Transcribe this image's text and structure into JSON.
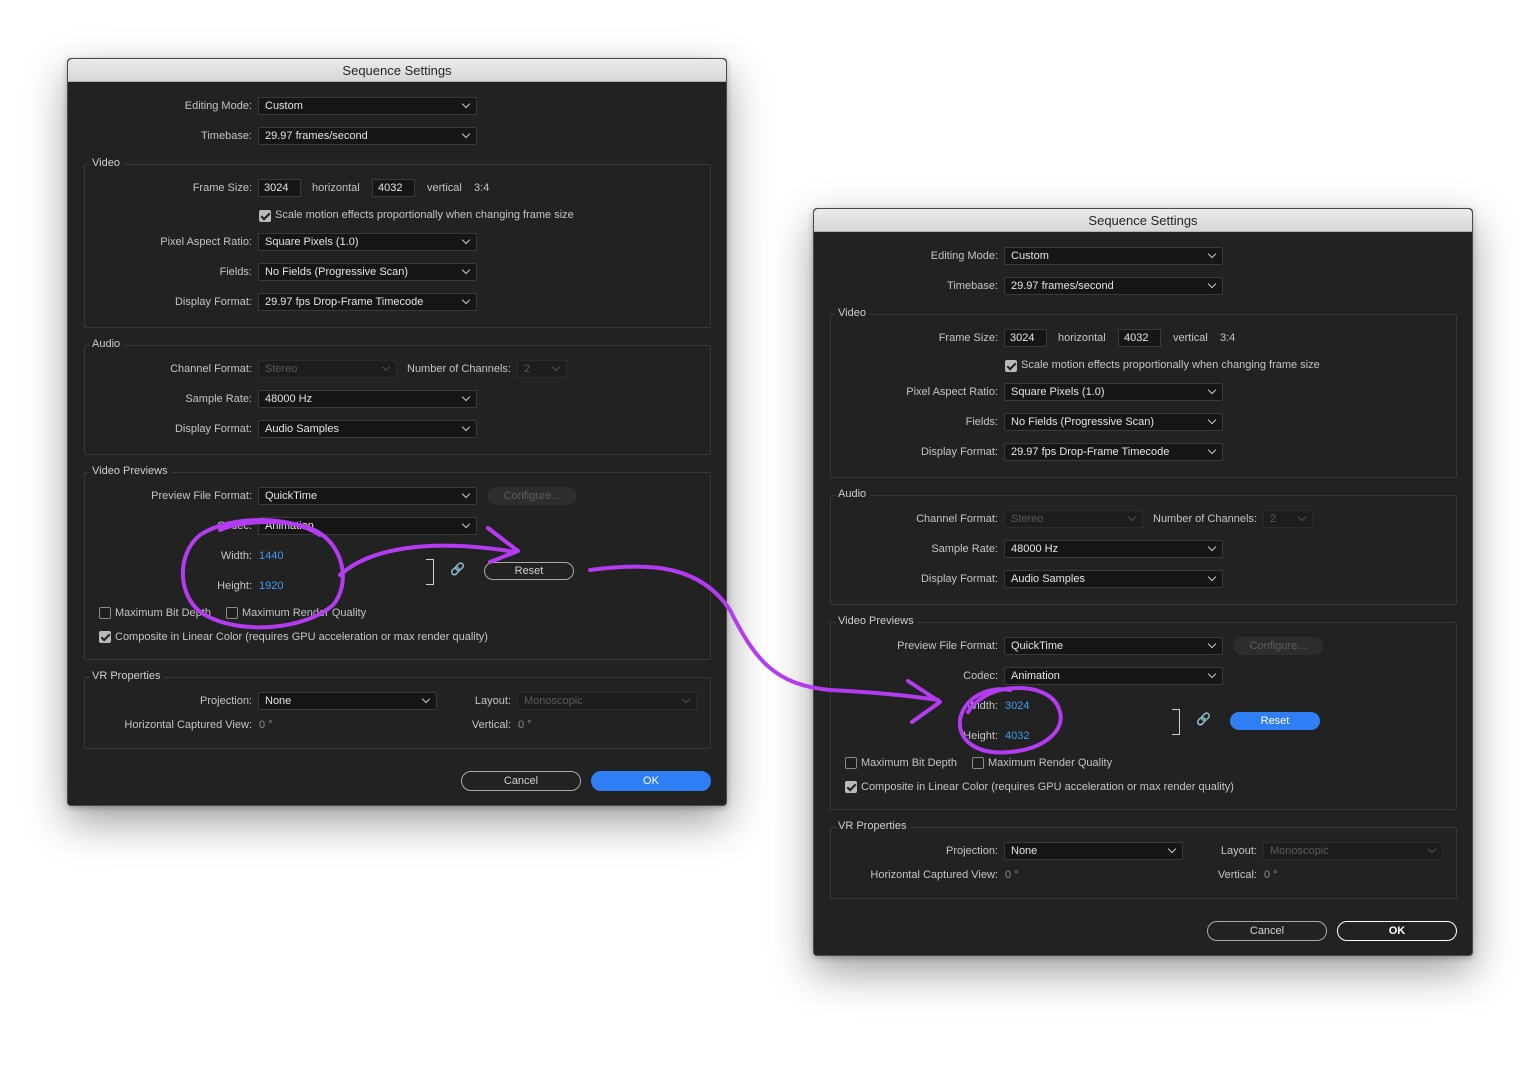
{
  "dialogs": [
    {
      "title": "Sequence Settings",
      "editing_mode": {
        "label": "Editing Mode:",
        "value": "Custom"
      },
      "timebase": {
        "label": "Timebase:",
        "value": "29.97  frames/second"
      },
      "video": {
        "section": "Video",
        "frame_size_label": "Frame Size:",
        "frame_width": "3024",
        "horizontal_label": "horizontal",
        "frame_height": "4032",
        "vertical_label": "vertical",
        "aspect": "3:4",
        "scale_checkbox_label": "Scale motion effects proportionally when changing frame size",
        "pixel_aspect": {
          "label": "Pixel Aspect Ratio:",
          "value": "Square Pixels (1.0)"
        },
        "fields": {
          "label": "Fields:",
          "value": "No Fields (Progressive Scan)"
        },
        "display_format": {
          "label": "Display Format:",
          "value": "29.97 fps Drop-Frame Timecode"
        }
      },
      "audio": {
        "section": "Audio",
        "channel_format": {
          "label": "Channel Format:",
          "value": "Stereo"
        },
        "channels": {
          "label": "Number of Channels:",
          "value": "2"
        },
        "sample_rate": {
          "label": "Sample Rate:",
          "value": "48000 Hz"
        },
        "display_format": {
          "label": "Display Format:",
          "value": "Audio Samples"
        }
      },
      "previews": {
        "section": "Video Previews",
        "file_format": {
          "label": "Preview File Format:",
          "value": "QuickTime"
        },
        "configure_label": "Configure...",
        "codec": {
          "label": "Codec:",
          "value": "Animation"
        },
        "width": {
          "label": "Width:",
          "value": "1440"
        },
        "height": {
          "label": "Height:",
          "value": "1920"
        },
        "reset_label": "Reset",
        "link_glyph": "🔗",
        "max_bit_depth_label": "Maximum Bit Depth",
        "max_render_label": "Maximum Render Quality",
        "composite_label": "Composite in Linear Color (requires GPU acceleration or max render quality)"
      },
      "vr": {
        "section": "VR Properties",
        "projection": {
          "label": "Projection:",
          "value": "None"
        },
        "layout": {
          "label": "Layout:",
          "value": "Monoscopic"
        },
        "hcv": {
          "label": "Horizontal Captured View:",
          "value": "0 °"
        },
        "vertical": {
          "label": "Vertical:",
          "value": "0 °"
        }
      },
      "cancel_label": "Cancel",
      "ok_label": "OK"
    },
    {
      "title": "Sequence Settings",
      "editing_mode": {
        "label": "Editing Mode:",
        "value": "Custom"
      },
      "timebase": {
        "label": "Timebase:",
        "value": "29.97  frames/second"
      },
      "video": {
        "section": "Video",
        "frame_size_label": "Frame Size:",
        "frame_width": "3024",
        "horizontal_label": "horizontal",
        "frame_height": "4032",
        "vertical_label": "vertical",
        "aspect": "3:4",
        "scale_checkbox_label": "Scale motion effects proportionally when changing frame size",
        "pixel_aspect": {
          "label": "Pixel Aspect Ratio:",
          "value": "Square Pixels (1.0)"
        },
        "fields": {
          "label": "Fields:",
          "value": "No Fields (Progressive Scan)"
        },
        "display_format": {
          "label": "Display Format:",
          "value": "29.97 fps Drop-Frame Timecode"
        }
      },
      "audio": {
        "section": "Audio",
        "channel_format": {
          "label": "Channel Format:",
          "value": "Stereo"
        },
        "channels": {
          "label": "Number of Channels:",
          "value": "2"
        },
        "sample_rate": {
          "label": "Sample Rate:",
          "value": "48000 Hz"
        },
        "display_format": {
          "label": "Display Format:",
          "value": "Audio Samples"
        }
      },
      "previews": {
        "section": "Video Previews",
        "file_format": {
          "label": "Preview File Format:",
          "value": "QuickTime"
        },
        "configure_label": "Configure...",
        "codec": {
          "label": "Codec:",
          "value": "Animation"
        },
        "width": {
          "label": "Width:",
          "value": "3024"
        },
        "height": {
          "label": "Height:",
          "value": "4032"
        },
        "reset_label": "Reset",
        "link_glyph": "🔗",
        "max_bit_depth_label": "Maximum Bit Depth",
        "max_render_label": "Maximum Render Quality",
        "composite_label": "Composite in Linear Color (requires GPU acceleration or max render quality)"
      },
      "vr": {
        "section": "VR Properties",
        "projection": {
          "label": "Projection:",
          "value": "None"
        },
        "layout": {
          "label": "Layout:",
          "value": "Monoscopic"
        },
        "hcv": {
          "label": "Horizontal Captured View:",
          "value": "0 °"
        },
        "vertical": {
          "label": "Vertical:",
          "value": "0 °"
        }
      },
      "cancel_label": "Cancel",
      "ok_label": "OK"
    }
  ],
  "annotation": {
    "color": "#b43cf0"
  }
}
